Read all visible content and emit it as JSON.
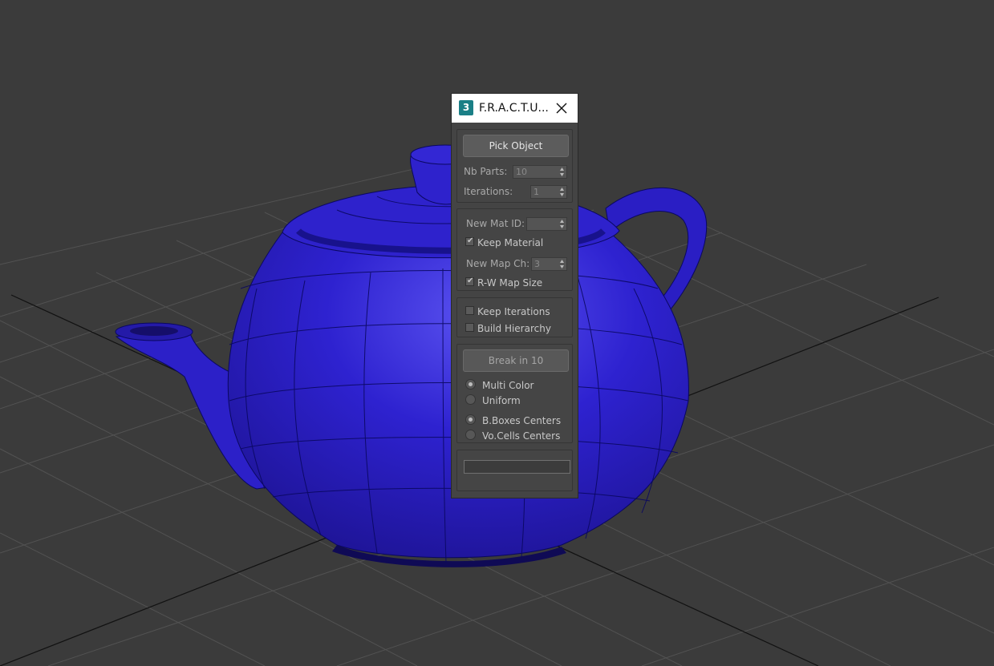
{
  "viewport": {
    "background": "#3b3b3b",
    "grid_color": "#525252",
    "axis_color": "#111111",
    "teapot_color": "#2b1fc2"
  },
  "dialog": {
    "title": "F.R.A.C.T.U...",
    "app_icon": "3",
    "close_icon": "close-icon",
    "pick_object_label": "Pick Object",
    "nb_parts_label": "Nb Parts:",
    "nb_parts_value": "10",
    "iterations_label": "Iterations:",
    "iterations_value": "1",
    "new_mat_id_label": "New Mat ID:",
    "new_mat_id_value": "",
    "keep_material_label": "Keep Material",
    "keep_material_checked": true,
    "new_map_ch_label": "New Map Ch:",
    "new_map_ch_value": "3",
    "rw_map_size_label": "R-W Map Size",
    "rw_map_size_checked": true,
    "keep_iterations_label": "Keep Iterations",
    "keep_iterations_checked": false,
    "build_hierarchy_label": "Build Hierarchy",
    "build_hierarchy_checked": false,
    "break_label": "Break in 10",
    "color_options": [
      "Multi Color",
      "Uniform"
    ],
    "color_selected": "Multi Color",
    "center_options": [
      "B.Boxes Centers",
      "Vo.Cells Centers"
    ],
    "center_selected": "B.Boxes Centers",
    "progress": 0
  }
}
